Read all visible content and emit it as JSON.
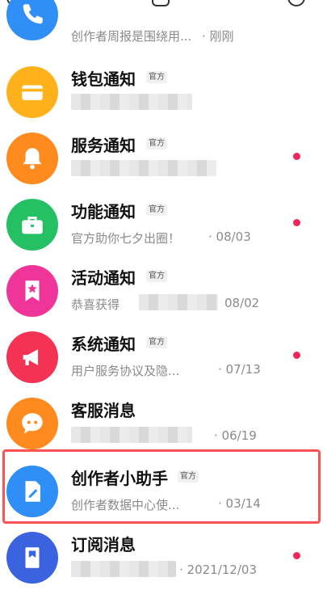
{
  "rows": [
    {
      "title": "",
      "subtitle": "创作者周报是围绕用...",
      "time": "· 刚刚",
      "badge": "",
      "icon": "phone-icon",
      "color": "#2f8ff7"
    },
    {
      "title": "钱包通知",
      "subtitle": "",
      "time": "",
      "badge": "官方",
      "icon": "card-icon",
      "color": "#ffb11b"
    },
    {
      "title": "服务通知",
      "subtitle": "",
      "time": "",
      "badge": "官方",
      "icon": "bell-icon",
      "color": "#ff8a1e"
    },
    {
      "title": "功能通知",
      "subtitle": "官方助你七夕出圈！",
      "time": "· 08/03",
      "badge": "官方",
      "icon": "briefcase-icon",
      "color": "#25c064"
    },
    {
      "title": "活动通知",
      "subtitle": "恭喜获得",
      "time": "08/02",
      "badge": "官方",
      "icon": "star-bookmark-icon",
      "color": "#f0359a"
    },
    {
      "title": "系统通知",
      "subtitle": "用户服务协议及隐...",
      "time": "· 07/13",
      "badge": "官方",
      "icon": "megaphone-icon",
      "color": "#f43354"
    },
    {
      "title": "客服消息",
      "subtitle": "",
      "time": "· 06/19",
      "badge": "",
      "icon": "chat-icon",
      "color": "#ff8a1e"
    },
    {
      "title": "创作者小助手",
      "subtitle": "创作者数据中心使...",
      "time": "· 03/14",
      "badge": "官方",
      "icon": "edit-icon",
      "color": "#2f8ff7"
    },
    {
      "title": "订阅消息",
      "subtitle": "",
      "time": "· 2021/12/03",
      "badge": "",
      "icon": "document-icon",
      "color": "#3b63e0"
    }
  ]
}
